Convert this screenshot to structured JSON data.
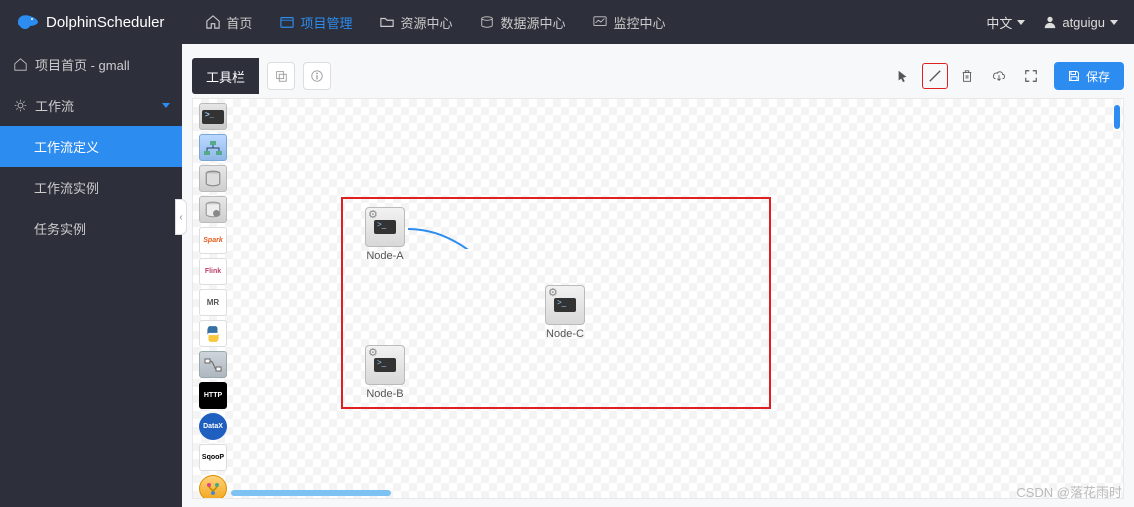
{
  "brand": "DolphinScheduler",
  "topnav": {
    "home": "首页",
    "project": "项目管理",
    "resource": "资源中心",
    "datasource": "数据源中心",
    "monitor": "监控中心"
  },
  "topbar_right": {
    "language": "中文",
    "username": "atguigu"
  },
  "sidebar": {
    "project_home": "项目首页 - gmall",
    "workflow": "工作流",
    "workflow_def": "工作流定义",
    "workflow_inst": "工作流实例",
    "task_inst": "任务实例"
  },
  "toolbar": {
    "label": "工具栏",
    "save_label": "保存"
  },
  "palette": {
    "shell": "SHELL",
    "sub": "SUB",
    "sql": "SQL",
    "proc": "PROC",
    "spark": "Spark",
    "flink": "Flink",
    "mr": "MR",
    "python": "py",
    "dep": "DEP",
    "http": "HTTP",
    "datax": "DataX",
    "sqoop": "SqooP",
    "cond": "⇄"
  },
  "nodes": {
    "a": "Node-A",
    "b": "Node-B",
    "c": "Node-C"
  },
  "watermark": "CSDN @落花雨时"
}
